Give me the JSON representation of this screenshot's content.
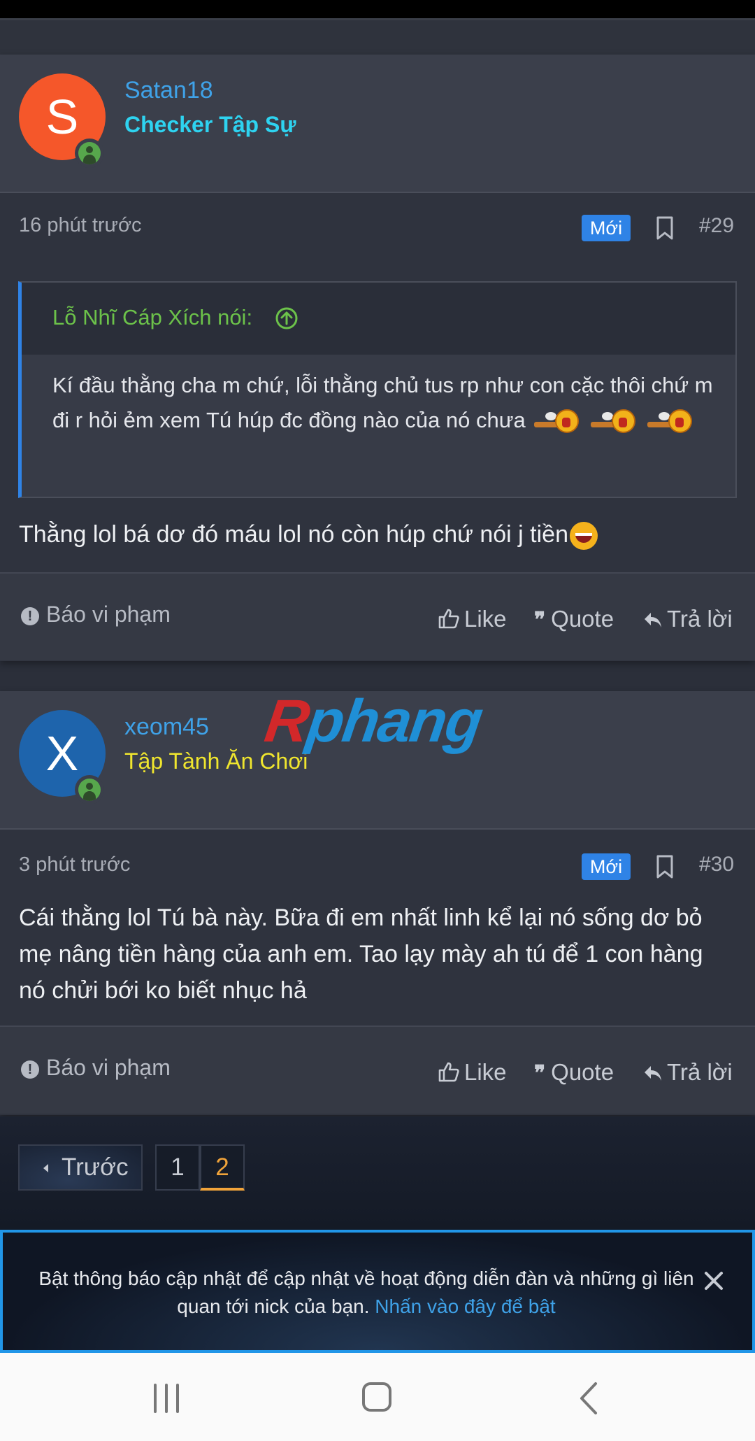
{
  "posts": [
    {
      "avatar_letter": "S",
      "avatar_color": "#f5572a",
      "username": "Satan18",
      "user_title": "Checker Tập Sự",
      "time": "16 phút trước",
      "badge": "Mới",
      "number": "#29",
      "quote": {
        "author": "Lỗ Nhĩ Cáp Xích nói:",
        "text": "Kí đầu thằng cha m chứ, lỗi thằng chủ tus rp như con cặc thôi chứ m đi r hỏi ẻm xem Tú húp đc đồng nào của nó chưa"
      },
      "text": "Thằng lol bá dơ đó máu lol nó còn húp chứ nói j tiền"
    },
    {
      "avatar_letter": "X",
      "avatar_color": "#1e64ac",
      "username": "xeom45",
      "user_title": "Tập Tành Ăn Chơi",
      "time": "3 phút trước",
      "badge": "Mới",
      "number": "#30",
      "text": "Cái thằng lol Tú bà này. Bữa đi em nhất linh kể lại nó sống dơ bỏ mẹ nâng tiền hàng của anh em. Tao lạy mày ah tú để 1 con hàng nó chửi bới ko biết nhục hả"
    }
  ],
  "actions": {
    "report": "Báo vi phạm",
    "like": "Like",
    "quote": "Quote",
    "reply": "Trả lời"
  },
  "watermark": {
    "first": "R",
    "rest": "phang"
  },
  "pagination": {
    "prev": "Trước",
    "pages": [
      "1",
      "2"
    ],
    "current": "2"
  },
  "notice": {
    "text": "Bật thông báo cập nhật để cập nhật về hoạt động diễn đàn và những gì liên quan tới nick của bạn.",
    "link": "Nhấn vào đây để bật"
  },
  "colors": {
    "accent": "#2f83e6",
    "username": "#3fa2e8",
    "current_page": "#f0a33a"
  },
  "icons": [
    "bookmark-icon",
    "arrow-up-circle-icon",
    "thumbs-up-icon",
    "quote-icon",
    "reply-icon",
    "report-icon",
    "close-icon",
    "online-user-icon"
  ]
}
